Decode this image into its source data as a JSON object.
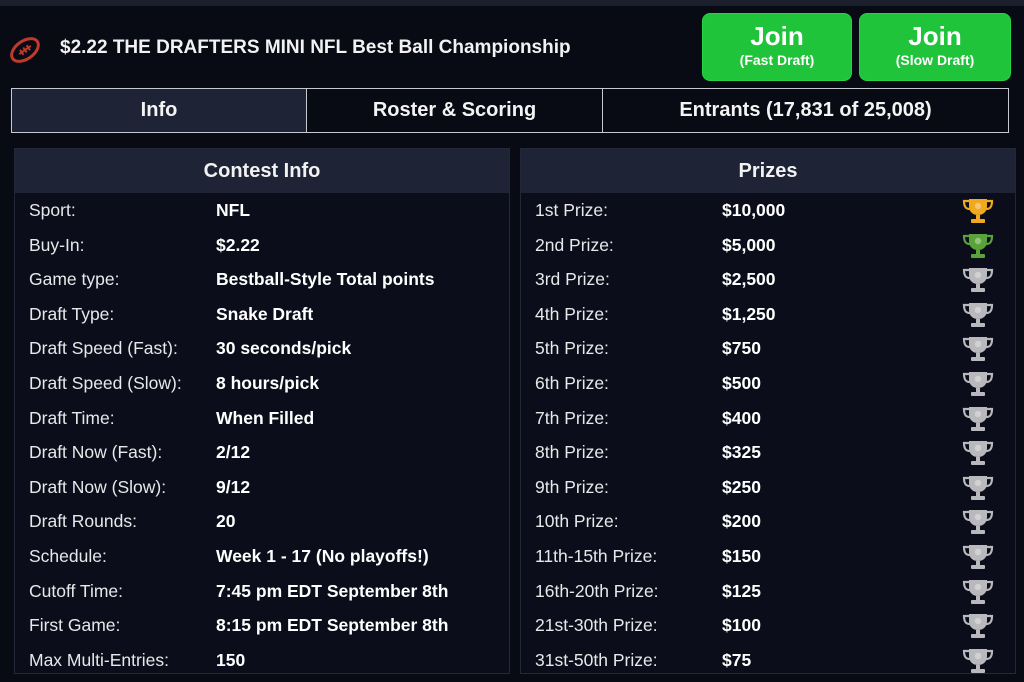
{
  "header": {
    "title": "$2.22 THE DRAFTERS MINI NFL Best Ball Championship",
    "sport_icon": "football-icon",
    "join_fast": {
      "main": "Join",
      "sub": "(Fast Draft)"
    },
    "join_slow": {
      "main": "Join",
      "sub": "(Slow Draft)"
    }
  },
  "tabs": [
    {
      "label": "Info",
      "active": true
    },
    {
      "label": "Roster & Scoring",
      "active": false
    },
    {
      "label": "Entrants (17,831 of 25,008)",
      "active": false
    }
  ],
  "contest_info": {
    "title": "Contest Info",
    "rows": [
      {
        "label": "Sport:",
        "value": "NFL"
      },
      {
        "label": "Buy-In:",
        "value": "$2.22"
      },
      {
        "label": "Game type:",
        "value": "Bestball-Style Total points"
      },
      {
        "label": "Draft Type:",
        "value": "Snake Draft"
      },
      {
        "label": "Draft Speed (Fast):",
        "value": "30 seconds/pick"
      },
      {
        "label": "Draft Speed (Slow):",
        "value": "8 hours/pick"
      },
      {
        "label": "Draft Time:",
        "value": "When Filled"
      },
      {
        "label": "Draft Now (Fast):",
        "value": "2/12"
      },
      {
        "label": "Draft Now (Slow):",
        "value": "9/12"
      },
      {
        "label": "Draft Rounds:",
        "value": "20"
      },
      {
        "label": "Schedule:",
        "value": "Week 1 - 17 (No playoffs!)"
      },
      {
        "label": "Cutoff Time:",
        "value": "7:45 pm EDT September 8th"
      },
      {
        "label": "First Game:",
        "value": "8:15 pm EDT September 8th"
      },
      {
        "label": "Max Multi-Entries:",
        "value": "150"
      }
    ]
  },
  "prizes": {
    "title": "Prizes",
    "rows": [
      {
        "label": "1st Prize:",
        "value": "$10,000",
        "trophy": "gold-trophy-icon",
        "color": "#f0a81f"
      },
      {
        "label": "2nd Prize:",
        "value": "$5,000",
        "trophy": "green-trophy-icon",
        "color": "#5aa33a"
      },
      {
        "label": "3rd Prize:",
        "value": "$2,500",
        "trophy": "silver-trophy-icon",
        "color": "#b9b9bd"
      },
      {
        "label": "4th Prize:",
        "value": "$1,250",
        "trophy": "silver-trophy-icon",
        "color": "#b9b9bd"
      },
      {
        "label": "5th Prize:",
        "value": "$750",
        "trophy": "silver-trophy-icon",
        "color": "#b9b9bd"
      },
      {
        "label": "6th Prize:",
        "value": "$500",
        "trophy": "silver-trophy-icon",
        "color": "#b9b9bd"
      },
      {
        "label": "7th Prize:",
        "value": "$400",
        "trophy": "silver-trophy-icon",
        "color": "#b9b9bd"
      },
      {
        "label": "8th Prize:",
        "value": "$325",
        "trophy": "silver-trophy-icon",
        "color": "#b9b9bd"
      },
      {
        "label": "9th Prize:",
        "value": "$250",
        "trophy": "silver-trophy-icon",
        "color": "#b9b9bd"
      },
      {
        "label": "10th Prize:",
        "value": "$200",
        "trophy": "silver-trophy-icon",
        "color": "#b9b9bd"
      },
      {
        "label": "11th-15th Prize:",
        "value": "$150",
        "trophy": "silver-trophy-icon",
        "color": "#b9b9bd"
      },
      {
        "label": "16th-20th Prize:",
        "value": "$125",
        "trophy": "silver-trophy-icon",
        "color": "#b9b9bd"
      },
      {
        "label": "21st-30th Prize:",
        "value": "$100",
        "trophy": "silver-trophy-icon",
        "color": "#b9b9bd"
      },
      {
        "label": "31st-50th Prize:",
        "value": "$75",
        "trophy": "silver-trophy-icon",
        "color": "#b9b9bd"
      }
    ]
  },
  "colors": {
    "background": "#080a14",
    "panel_header": "#1e2435",
    "join_green": "#1fc43b",
    "football_red": "#c0392b"
  }
}
